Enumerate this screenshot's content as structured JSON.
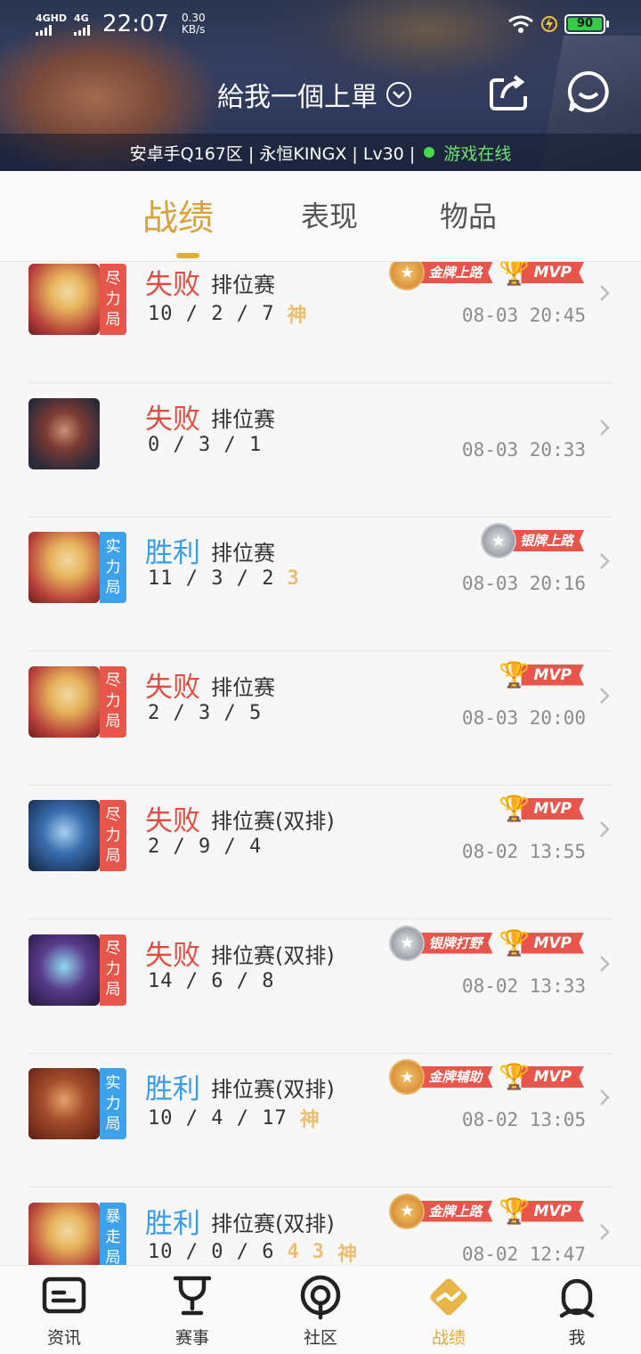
{
  "status_bar": {
    "signal1": "4GHD",
    "signal2": "4G",
    "time": "22:07",
    "speed_value": "0.30",
    "speed_unit": "KB/s",
    "battery": "90"
  },
  "header": {
    "nickname": "給我一個上單",
    "info": "安卓手Q167区 | 永恒KINGX | Lv30 |",
    "online_status": "游戏在线"
  },
  "tabs": [
    {
      "label": "战绩"
    },
    {
      "label": "表现"
    },
    {
      "label": "物品"
    }
  ],
  "matches": [
    {
      "tag": [
        "尽",
        "力",
        "局"
      ],
      "result": "失败",
      "mode": "排位赛",
      "kda": "10 / 2 / 7",
      "marks": [
        "神"
      ],
      "badges": [
        {
          "kind": "gold",
          "label": "金牌上路"
        },
        {
          "kind": "mvp",
          "label": "MVP"
        }
      ],
      "date": "08-03 20:45"
    },
    {
      "tag": [],
      "result": "失败",
      "mode": "排位赛",
      "kda": "0 / 3 / 1",
      "marks": [],
      "badges": [],
      "date": "08-03 20:33"
    },
    {
      "tag": [
        "实",
        "力",
        "局"
      ],
      "result": "胜利",
      "mode": "排位赛",
      "kda": "11 / 3 / 2",
      "marks": [
        "3"
      ],
      "badges": [
        {
          "kind": "silver",
          "label": "银牌上路"
        }
      ],
      "date": "08-03 20:16"
    },
    {
      "tag": [
        "尽",
        "力",
        "局"
      ],
      "result": "失败",
      "mode": "排位赛",
      "kda": "2 / 3 / 5",
      "marks": [],
      "badges": [
        {
          "kind": "mvp",
          "label": "MVP"
        }
      ],
      "date": "08-03 20:00"
    },
    {
      "tag": [
        "尽",
        "力",
        "局"
      ],
      "result": "失败",
      "mode": "排位赛(双排)",
      "kda": "2 / 9 / 4",
      "marks": [],
      "badges": [
        {
          "kind": "mvp",
          "label": "MVP"
        }
      ],
      "date": "08-02 13:55"
    },
    {
      "tag": [
        "尽",
        "力",
        "局"
      ],
      "result": "失败",
      "mode": "排位赛(双排)",
      "kda": "14 / 6 / 8",
      "marks": [],
      "badges": [
        {
          "kind": "silver",
          "label": "银牌打野"
        },
        {
          "kind": "mvp",
          "label": "MVP"
        }
      ],
      "date": "08-02 13:33"
    },
    {
      "tag": [
        "实",
        "力",
        "局"
      ],
      "result": "胜利",
      "mode": "排位赛(双排)",
      "kda": "10 / 4 / 17",
      "marks": [
        "神"
      ],
      "badges": [
        {
          "kind": "gold",
          "label": "金牌辅助"
        },
        {
          "kind": "mvp",
          "label": "MVP"
        }
      ],
      "date": "08-02 13:05"
    },
    {
      "tag": [
        "暴",
        "走",
        "局"
      ],
      "result": "胜利",
      "mode": "排位赛(双排)",
      "kda": "10 / 0 / 6",
      "marks": [
        "4",
        "3",
        "神"
      ],
      "badges": [
        {
          "kind": "gold",
          "label": "金牌上路"
        },
        {
          "kind": "mvp",
          "label": "MVP"
        }
      ],
      "date": "08-02 12:47"
    }
  ],
  "bottom_nav": [
    {
      "label": "资讯"
    },
    {
      "label": "赛事"
    },
    {
      "label": "社区"
    },
    {
      "label": "战绩"
    },
    {
      "label": "我"
    }
  ],
  "colors": {
    "accent": "#e2a93c",
    "lose": "#e14e3e",
    "win": "#3a9be6",
    "tag_red": "#e8564b",
    "tag_blue": "#3ea2ea"
  }
}
